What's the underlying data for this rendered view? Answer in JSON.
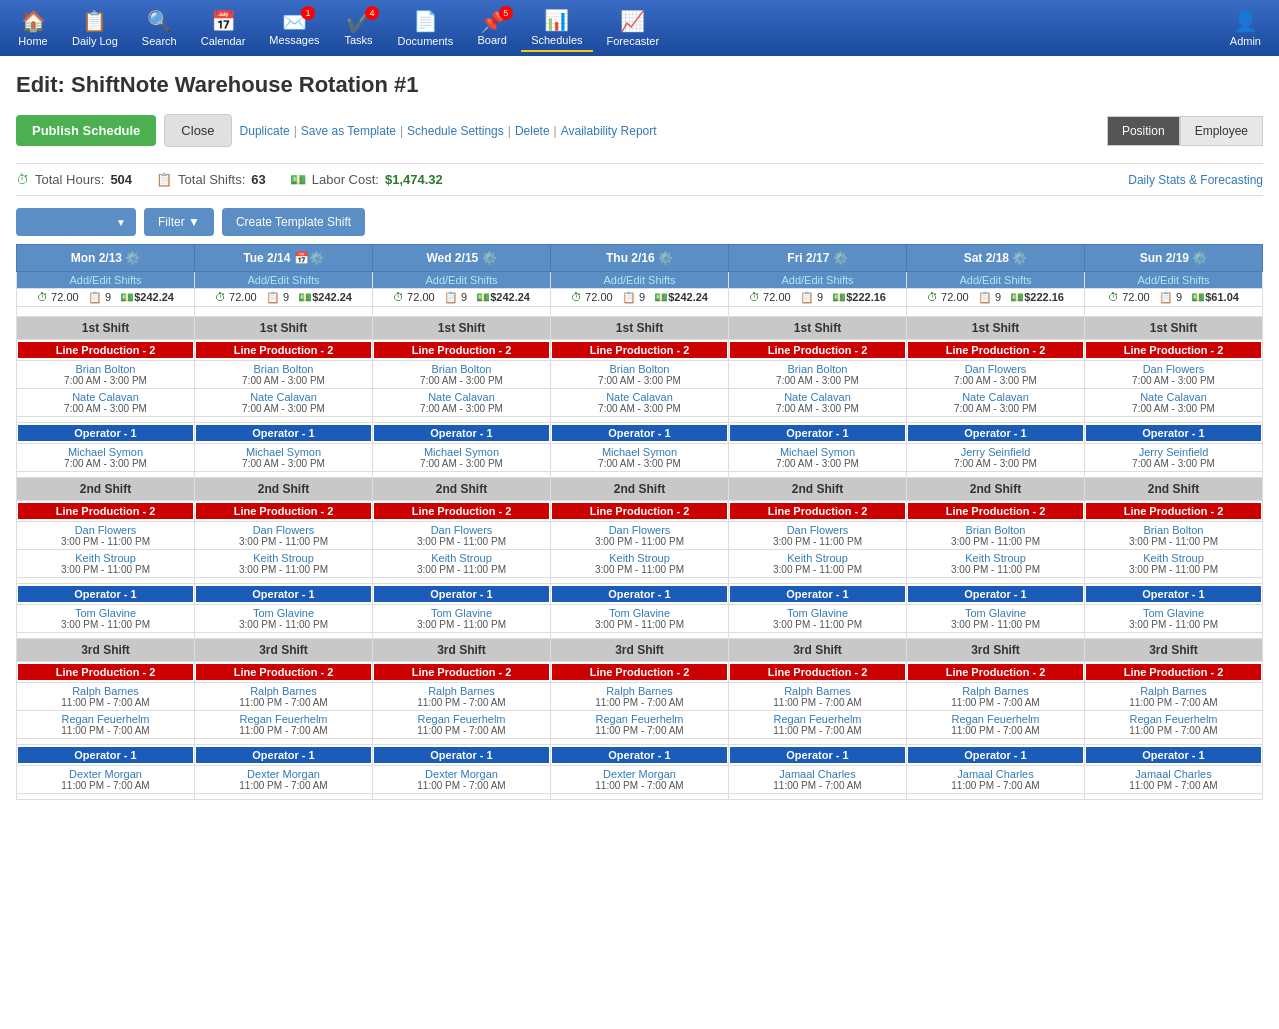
{
  "nav": {
    "items": [
      {
        "label": "Home",
        "icon": "🏠",
        "badge": null,
        "active": false
      },
      {
        "label": "Daily Log",
        "icon": "📋",
        "badge": null,
        "active": false
      },
      {
        "label": "Search",
        "icon": "🔍",
        "badge": null,
        "active": false
      },
      {
        "label": "Calendar",
        "icon": "📅",
        "badge": null,
        "active": false
      },
      {
        "label": "Messages",
        "icon": "✉️",
        "badge": "1",
        "active": false
      },
      {
        "label": "Tasks",
        "icon": "✔️",
        "badge": "4",
        "active": false
      },
      {
        "label": "Documents",
        "icon": "📄",
        "badge": null,
        "active": false
      },
      {
        "label": "Board",
        "icon": "📌",
        "badge": "5",
        "active": false
      },
      {
        "label": "Schedules",
        "icon": "📊",
        "badge": null,
        "active": true
      },
      {
        "label": "Forecaster",
        "icon": "📈",
        "badge": null,
        "active": false
      }
    ],
    "admin_label": "Admin",
    "admin_icon": "👤"
  },
  "page": {
    "title": "Edit: ShiftNote Warehouse Rotation #1"
  },
  "toolbar": {
    "publish_label": "Publish Schedule",
    "close_label": "Close",
    "links": [
      "Duplicate",
      "Save as Template",
      "Schedule Settings",
      "Delete",
      "Availability Report"
    ],
    "view_position": "Position",
    "view_employee": "Employee"
  },
  "stats": {
    "total_hours_label": "Total Hours:",
    "total_hours_value": "504",
    "total_shifts_label": "Total Shifts:",
    "total_shifts_value": "63",
    "labor_cost_label": "Labor Cost:",
    "labor_cost_value": "$1,474.32",
    "daily_stats_link": "Daily Stats & Forecasting"
  },
  "controls": {
    "dropdown_placeholder": "",
    "filter_label": "Filter ▼",
    "create_template_label": "Create Template Shift"
  },
  "days": [
    {
      "label": "Mon 2/13",
      "icon": "⚙️"
    },
    {
      "label": "Tue 2/14",
      "icon": "⚙️"
    },
    {
      "label": "Wed 2/15",
      "icon": "⚙️"
    },
    {
      "label": "Thu 2/16",
      "icon": "⚙️"
    },
    {
      "label": "Fri 2/17",
      "icon": "⚙️"
    },
    {
      "label": "Sat 2/18",
      "icon": "⚙️"
    },
    {
      "label": "Sun 2/19",
      "icon": "⚙️"
    }
  ],
  "day_stats": [
    {
      "hours": "72.00",
      "shifts": "9",
      "cost": "$242.24"
    },
    {
      "hours": "72.00",
      "shifts": "9",
      "cost": "$242.24"
    },
    {
      "hours": "72.00",
      "shifts": "9",
      "cost": "$242.24"
    },
    {
      "hours": "72.00",
      "shifts": "9",
      "cost": "$242.24"
    },
    {
      "hours": "72.00",
      "shifts": "9",
      "cost": "$222.16"
    },
    {
      "hours": "72.00",
      "shifts": "9",
      "cost": "$222.16"
    },
    {
      "hours": "72.00",
      "shifts": "9",
      "cost": "$61.04"
    }
  ],
  "shifts": [
    {
      "name": "1st Shift",
      "positions": [
        {
          "type": "red",
          "label": "Line Production - 2",
          "employees": [
            [
              {
                "name": "Brian Bolton",
                "time": "7:00 AM - 3:00 PM"
              },
              {
                "name": "Brian Bolton",
                "time": "7:00 AM - 3:00 PM"
              },
              {
                "name": "Brian Bolton",
                "time": "7:00 AM - 3:00 PM"
              },
              {
                "name": "Brian Bolton",
                "time": "7:00 AM - 3:00 PM"
              },
              {
                "name": "Brian Bolton",
                "time": "7:00 AM - 3:00 PM"
              },
              {
                "name": "Dan Flowers",
                "time": "7:00 AM - 3:00 PM"
              },
              {
                "name": "Dan Flowers",
                "time": "7:00 AM - 3:00 PM"
              }
            ],
            [
              {
                "name": "Nate Calavan",
                "time": "7:00 AM - 3:00 PM"
              },
              {
                "name": "Nate Calavan",
                "time": "7:00 AM - 3:00 PM"
              },
              {
                "name": "Nate Calavan",
                "time": "7:00 AM - 3:00 PM"
              },
              {
                "name": "Nate Calavan",
                "time": "7:00 AM - 3:00 PM"
              },
              {
                "name": "Nate Calavan",
                "time": "7:00 AM - 3:00 PM"
              },
              {
                "name": "Nate Calavan",
                "time": "7:00 AM - 3:00 PM"
              },
              {
                "name": "Nate Calavan",
                "time": "7:00 AM - 3:00 PM"
              }
            ]
          ]
        },
        {
          "type": "blue",
          "label": "Operator - 1",
          "employees": [
            [
              {
                "name": "Michael Symon",
                "time": "7:00 AM - 3:00 PM"
              },
              {
                "name": "Michael Symon",
                "time": "7:00 AM - 3:00 PM"
              },
              {
                "name": "Michael Symon",
                "time": "7:00 AM - 3:00 PM"
              },
              {
                "name": "Michael Symon",
                "time": "7:00 AM - 3:00 PM"
              },
              {
                "name": "Michael Symon",
                "time": "7:00 AM - 3:00 PM"
              },
              {
                "name": "Jerry Seinfield",
                "time": "7:00 AM - 3:00 PM"
              },
              {
                "name": "Jerry Seinfield",
                "time": "7:00 AM - 3:00 PM"
              }
            ]
          ]
        }
      ]
    },
    {
      "name": "2nd Shift",
      "positions": [
        {
          "type": "red",
          "label": "Line Production - 2",
          "employees": [
            [
              {
                "name": "Dan Flowers",
                "time": "3:00 PM - 11:00 PM"
              },
              {
                "name": "Dan Flowers",
                "time": "3:00 PM - 11:00 PM"
              },
              {
                "name": "Dan Flowers",
                "time": "3:00 PM - 11:00 PM"
              },
              {
                "name": "Dan Flowers",
                "time": "3:00 PM - 11:00 PM"
              },
              {
                "name": "Dan Flowers",
                "time": "3:00 PM - 11:00 PM"
              },
              {
                "name": "Brian Bolton",
                "time": "3:00 PM - 11:00 PM"
              },
              {
                "name": "Brian Bolton",
                "time": "3:00 PM - 11:00 PM"
              }
            ],
            [
              {
                "name": "Keith Stroup",
                "time": "3:00 PM - 11:00 PM"
              },
              {
                "name": "Keith Stroup",
                "time": "3:00 PM - 11:00 PM"
              },
              {
                "name": "Keith Stroup",
                "time": "3:00 PM - 11:00 PM"
              },
              {
                "name": "Keith Stroup",
                "time": "3:00 PM - 11:00 PM"
              },
              {
                "name": "Keith Stroup",
                "time": "3:00 PM - 11:00 PM"
              },
              {
                "name": "Keith Stroup",
                "time": "3:00 PM - 11:00 PM"
              },
              {
                "name": "Keith Stroup",
                "time": "3:00 PM - 11:00 PM"
              }
            ]
          ]
        },
        {
          "type": "blue",
          "label": "Operator - 1",
          "employees": [
            [
              {
                "name": "Tom Glavine",
                "time": "3:00 PM - 11:00 PM"
              },
              {
                "name": "Tom Glavine",
                "time": "3:00 PM - 11:00 PM"
              },
              {
                "name": "Tom Glavine",
                "time": "3:00 PM - 11:00 PM"
              },
              {
                "name": "Tom Glavine",
                "time": "3:00 PM - 11:00 PM"
              },
              {
                "name": "Tom Glavine",
                "time": "3:00 PM - 11:00 PM"
              },
              {
                "name": "Tom Glavine",
                "time": "3:00 PM - 11:00 PM"
              },
              {
                "name": "Tom Glavine",
                "time": "3:00 PM - 11:00 PM"
              }
            ]
          ]
        }
      ]
    },
    {
      "name": "3rd Shift",
      "positions": [
        {
          "type": "red",
          "label": "Line Production - 2",
          "employees": [
            [
              {
                "name": "Ralph Barnes",
                "time": "11:00 PM - 7:00 AM"
              },
              {
                "name": "Ralph Barnes",
                "time": "11:00 PM - 7:00 AM"
              },
              {
                "name": "Ralph Barnes",
                "time": "11:00 PM - 7:00 AM"
              },
              {
                "name": "Ralph Barnes",
                "time": "11:00 PM - 7:00 AM"
              },
              {
                "name": "Ralph Barnes",
                "time": "11:00 PM - 7:00 AM"
              },
              {
                "name": "Ralph Barnes",
                "time": "11:00 PM - 7:00 AM"
              },
              {
                "name": "Ralph Barnes",
                "time": "11:00 PM - 7:00 AM"
              }
            ],
            [
              {
                "name": "Regan Feuerhelm",
                "time": "11:00 PM - 7:00 AM"
              },
              {
                "name": "Regan Feuerhelm",
                "time": "11:00 PM - 7:00 AM"
              },
              {
                "name": "Regan Feuerhelm",
                "time": "11:00 PM - 7:00 AM"
              },
              {
                "name": "Regan Feuerhelm",
                "time": "11:00 PM - 7:00 AM"
              },
              {
                "name": "Regan Feuerhelm",
                "time": "11:00 PM - 7:00 AM"
              },
              {
                "name": "Regan Feuerhelm",
                "time": "11:00 PM - 7:00 AM"
              },
              {
                "name": "Regan Feuerhelm",
                "time": "11:00 PM - 7:00 AM"
              }
            ]
          ]
        },
        {
          "type": "blue",
          "label": "Operator - 1",
          "employees": [
            [
              {
                "name": "Dexter Morgan",
                "time": "11:00 PM - 7:00 AM"
              },
              {
                "name": "Dexter Morgan",
                "time": "11:00 PM - 7:00 AM"
              },
              {
                "name": "Dexter Morgan",
                "time": "11:00 PM - 7:00 AM"
              },
              {
                "name": "Dexter Morgan",
                "time": "11:00 PM - 7:00 AM"
              },
              {
                "name": "Jamaal Charles",
                "time": "11:00 PM - 7:00 AM"
              },
              {
                "name": "Jamaal Charles",
                "time": "11:00 PM - 7:00 AM"
              },
              {
                "name": "Jamaal Charles",
                "time": "11:00 PM - 7:00 AM"
              }
            ]
          ]
        }
      ]
    }
  ],
  "add_edit_label": "Add/Edit Shifts"
}
